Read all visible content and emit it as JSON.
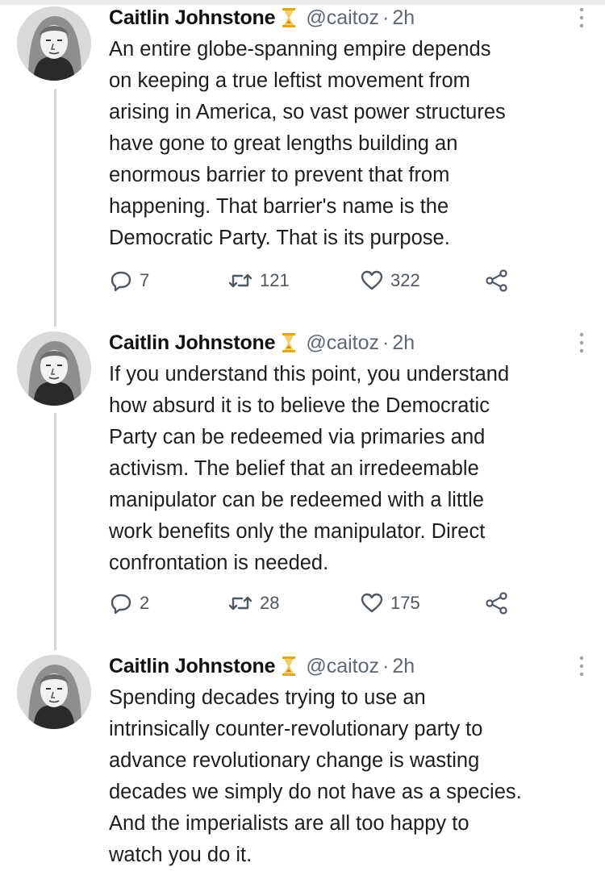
{
  "colors": {
    "text": "#1e1e1e",
    "muted": "#5f6872",
    "thread_line": "#d3d6da",
    "badge": "#e0a81c"
  },
  "tweets": [
    {
      "author": "Caitlin Johnstone",
      "handle": "@caitoz",
      "separator": "·",
      "time": "2h",
      "text": "An entire globe-spanning empire depends\non keeping a true leftist movement from\narising in America, so vast power structures\nhave gone to great lengths building an\nenormous barrier to prevent that from\nhappening. That barrier's name is the\nDemocratic Party. That is its purpose.",
      "replies": "7",
      "retweets": "121",
      "likes": "322"
    },
    {
      "author": "Caitlin Johnstone",
      "handle": "@caitoz",
      "separator": "·",
      "time": "2h",
      "text": "If you understand this point, you understand\nhow absurd it is to believe the Democratic\nParty can be redeemed via primaries and\nactivism. The belief that an irredeemable\nmanipulator can be redeemed with a little\nwork benefits only the manipulator. Direct\nconfrontation is needed.",
      "replies": "2",
      "retweets": "28",
      "likes": "175"
    },
    {
      "author": "Caitlin Johnstone",
      "handle": "@caitoz",
      "separator": "·",
      "time": "2h",
      "text": "Spending decades trying to use an\nintrinsically counter-revolutionary party to\nadvance revolutionary change is wasting\ndecades we simply do not have as a species.\nAnd the imperialists are all too happy to\nwatch you do it."
    }
  ]
}
